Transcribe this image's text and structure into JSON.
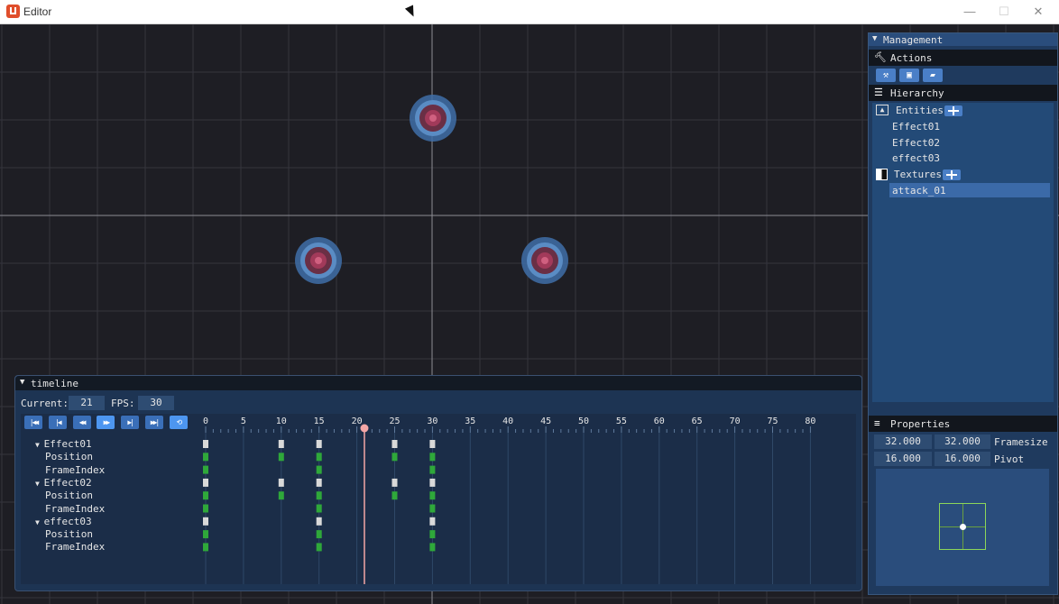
{
  "window": {
    "title": "Editor",
    "min": "—",
    "max": "☐",
    "close": "✕"
  },
  "timeline": {
    "title": "timeline",
    "current_label": "Current:",
    "current_value": "21",
    "fps_label": "FPS:",
    "fps_value": "30",
    "controls": [
      {
        "name": "first-frame",
        "glyph": "|◀◀"
      },
      {
        "name": "prev-frame",
        "glyph": "|◀"
      },
      {
        "name": "play-backward",
        "glyph": "◀◀"
      },
      {
        "name": "play-forward",
        "glyph": "▶▶"
      },
      {
        "name": "next-frame",
        "glyph": "▶|"
      },
      {
        "name": "last-frame",
        "glyph": "▶▶|"
      },
      {
        "name": "loop",
        "glyph": "⟲"
      }
    ],
    "ticks": [
      "0",
      "5",
      "10",
      "15",
      "20",
      "25",
      "30",
      "35",
      "40",
      "45",
      "50",
      "55",
      "60",
      "65",
      "70",
      "75",
      "80"
    ],
    "current_frame": 21,
    "tracks": [
      {
        "label": "Effect01",
        "type": "entity",
        "keys": [
          0,
          10,
          15,
          25,
          30
        ]
      },
      {
        "label": "Position",
        "type": "prop",
        "keys": [
          0,
          10,
          15,
          25,
          30
        ]
      },
      {
        "label": "FrameIndex",
        "type": "prop",
        "keys": [
          0,
          15,
          30
        ]
      },
      {
        "label": "Effect02",
        "type": "entity",
        "keys": [
          0,
          10,
          15,
          25,
          30
        ]
      },
      {
        "label": "Position",
        "type": "prop",
        "keys": [
          0,
          10,
          15,
          25,
          30
        ]
      },
      {
        "label": "FrameIndex",
        "type": "prop",
        "keys": [
          0,
          15,
          30
        ]
      },
      {
        "label": "effect03",
        "type": "entity",
        "keys": [
          0,
          15,
          30
        ]
      },
      {
        "label": "Position",
        "type": "prop",
        "keys": [
          0,
          15,
          30
        ]
      },
      {
        "label": "FrameIndex",
        "type": "prop",
        "keys": [
          0,
          15,
          30
        ]
      }
    ]
  },
  "management": {
    "title": "Management",
    "actions_title": "Actions",
    "hierarchy_title": "Hierarchy",
    "entities_label": "Entities",
    "entities": [
      "Effect01",
      "Effect02",
      "effect03"
    ],
    "textures_label": "Textures",
    "textures": [
      "attack_01"
    ],
    "properties_title": "Properties",
    "framesize": {
      "x": "32.000",
      "y": "32.000",
      "label": "Framesize"
    },
    "pivot": {
      "x": "16.000",
      "y": "16.000",
      "label": "Pivot"
    }
  },
  "colors": {
    "keyframe_entity": "#d9d9d9",
    "keyframe_prop": "#2fa83a",
    "playhead": "#f4a6a6"
  }
}
